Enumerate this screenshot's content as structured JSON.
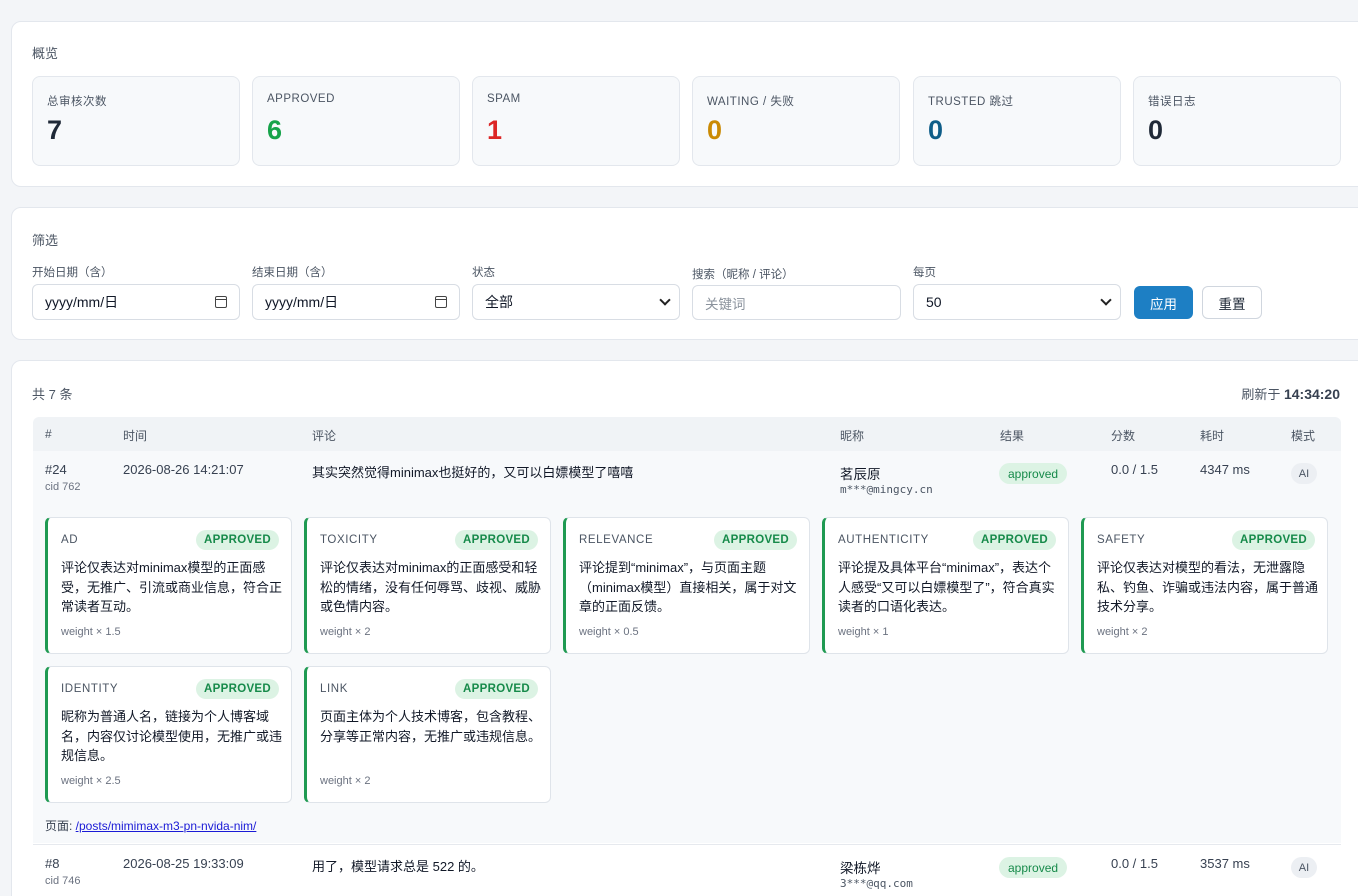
{
  "overview": {
    "title": "概览",
    "stats": [
      {
        "label": "总审核次数",
        "value": "7",
        "color": "#1f2937"
      },
      {
        "label": "APPROVED",
        "value": "6",
        "color": "#16a34a"
      },
      {
        "label": "SPAM",
        "value": "1",
        "color": "#dc2626"
      },
      {
        "label": "WAITING / 失败",
        "value": "0",
        "color": "#ca8a04"
      },
      {
        "label": "TRUSTED 跳过",
        "value": "0",
        "color": "#0e5d88"
      },
      {
        "label": "错误日志",
        "value": "0",
        "color": "#1f2937"
      }
    ]
  },
  "filter": {
    "title": "筛选",
    "start_label": "开始日期（含）",
    "start_value": "yyyy/mm/日",
    "end_label": "结束日期（含）",
    "end_value": "yyyy/mm/日",
    "status_label": "状态",
    "status_value": "全部",
    "search_label": "搜索（昵称 / 评论）",
    "search_placeholder": "关键词",
    "per_page_label": "每页",
    "per_page_value": "50",
    "apply_label": "应用",
    "reset_label": "重置"
  },
  "results": {
    "count_text": "共 7 条",
    "refresh_prefix": "刷新于 ",
    "refresh_time": "14:34:20",
    "columns": [
      "#",
      "时间",
      "评论",
      "昵称",
      "结果",
      "分数",
      "耗时",
      "模式"
    ],
    "rows": [
      {
        "id": "#24",
        "cid": "cid 762",
        "time": "2026-08-26 14:21:07",
        "comment": "其实突然觉得minimax也挺好的，又可以白嫖模型了嘻嘻",
        "nick": "茗辰原",
        "email": "m***@mingcy.cn",
        "result": "approved",
        "score": "0.0 / 1.5",
        "duration": "4347 ms",
        "mode": "AI",
        "checks": [
          {
            "name": "AD",
            "status": "APPROVED",
            "text": "评论仅表达对minimax模型的正面感受，无推广、引流或商业信息，符合正常读者互动。",
            "weight": "weight × 1.5"
          },
          {
            "name": "TOXICITY",
            "status": "APPROVED",
            "text": "评论仅表达对minimax的正面感受和轻松的情绪，没有任何辱骂、歧视、威胁或色情内容。",
            "weight": "weight × 2"
          },
          {
            "name": "RELEVANCE",
            "status": "APPROVED",
            "text": "评论提到“minimax”，与页面主题（minimax模型）直接相关，属于对文章的正面反馈。",
            "weight": "weight × 0.5"
          },
          {
            "name": "AUTHENTICITY",
            "status": "APPROVED",
            "text": "评论提及具体平台“minimax”，表达个人感受“又可以白嫖模型了”，符合真实读者的口语化表达。",
            "weight": "weight × 1"
          },
          {
            "name": "SAFETY",
            "status": "APPROVED",
            "text": "评论仅表达对模型的看法，无泄露隐私、钓鱼、诈骗或违法内容，属于普通技术分享。",
            "weight": "weight × 2"
          },
          {
            "name": "IDENTITY",
            "status": "APPROVED",
            "text": "昵称为普通人名，链接为个人博客域名，内容仅讨论模型使用，无推广或违规信息。",
            "weight": "weight × 2.5"
          },
          {
            "name": "LINK",
            "status": "APPROVED",
            "text": "页面主体为个人技术博客，包含教程、分享等正常内容，无推广或违规信息。",
            "weight": "weight × 2"
          }
        ],
        "page_prefix": "页面: ",
        "page_link": "/posts/mimimax-m3-pn-nvida-nim/"
      },
      {
        "id": "#8",
        "cid": "cid 746",
        "time": "2026-08-25 19:33:09",
        "comment": "用了，模型请求总是 522 的。",
        "nick": "梁栋烨",
        "email": "3***@qq.com",
        "result": "approved",
        "score": "0.0 / 1.5",
        "duration": "3537 ms",
        "mode": "AI"
      }
    ]
  }
}
